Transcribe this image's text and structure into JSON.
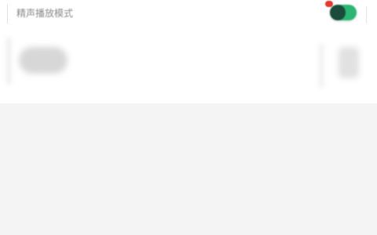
{
  "settings": {
    "mode_label": "精声播放模式",
    "toggle_state": "on",
    "toggle_color": "#2bb673",
    "badge_color": "#e03b2e"
  },
  "content": {
    "left_item_icon": "blurred-avatar-icon",
    "right_item_icon": "blurred-settings-icon"
  }
}
